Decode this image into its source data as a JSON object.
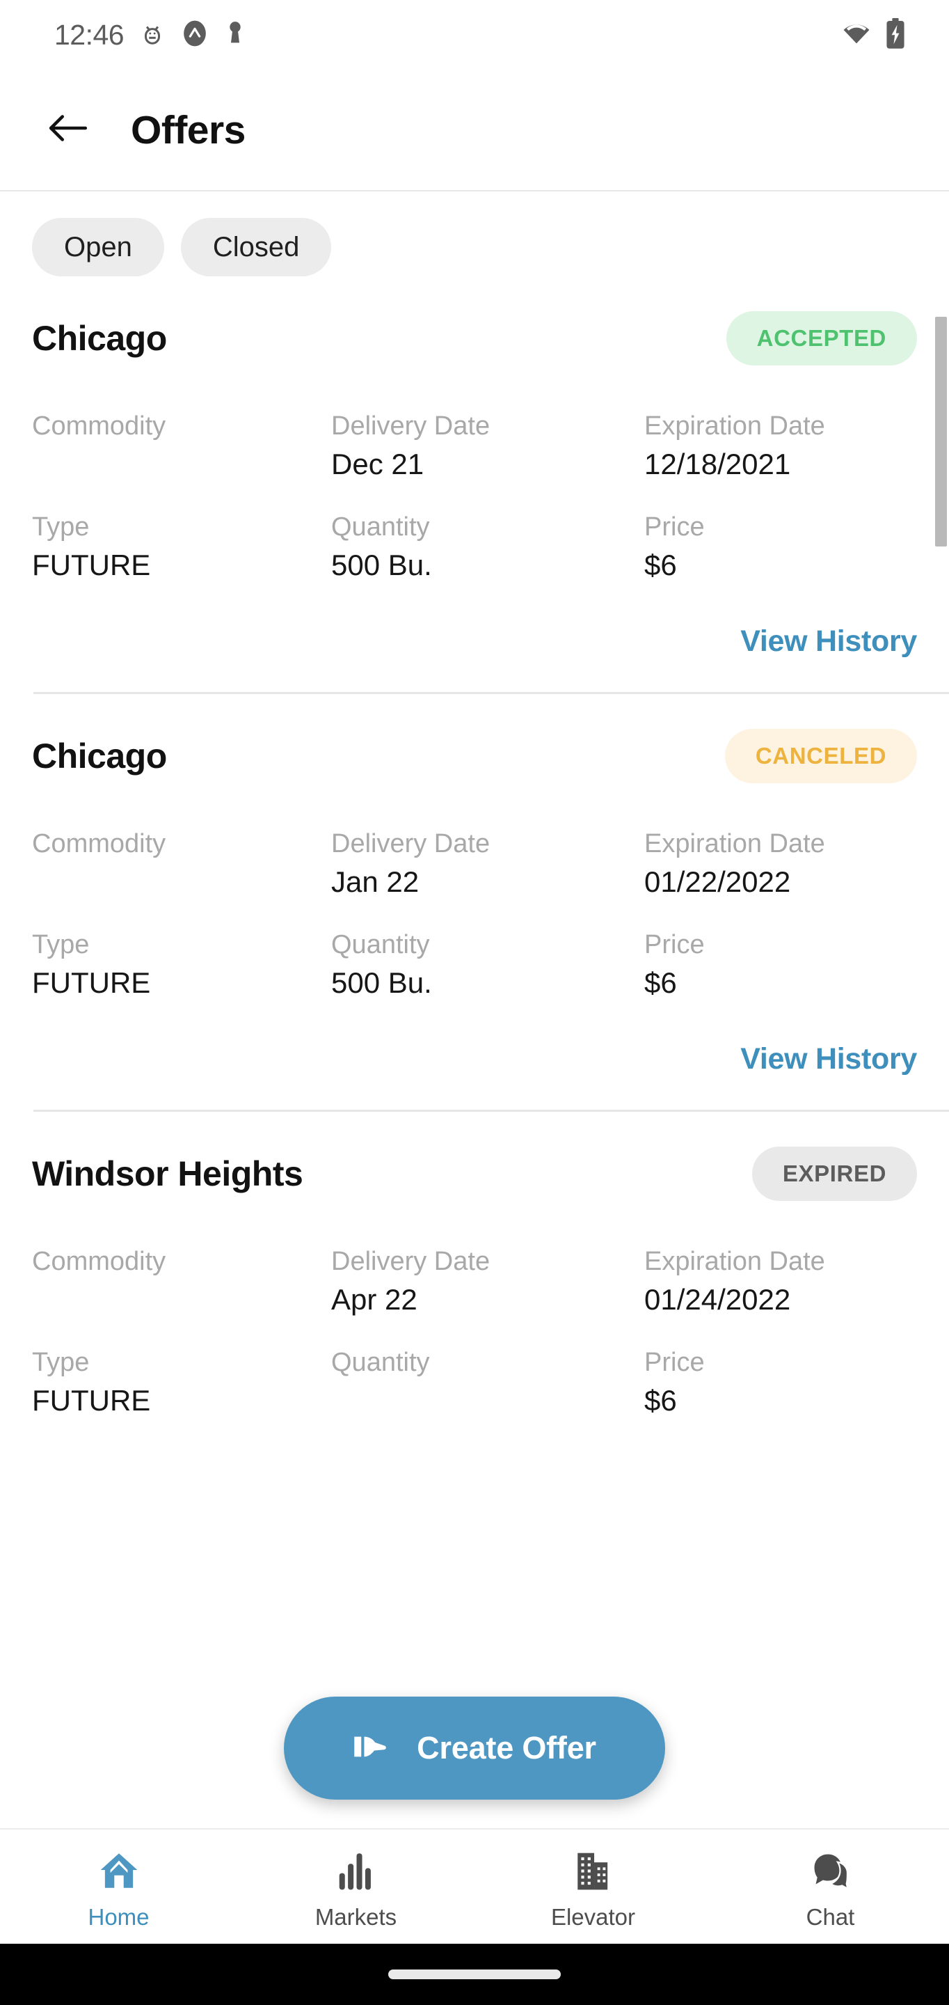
{
  "status_bar": {
    "time": "12:46",
    "left_icons": [
      "android-debug-icon",
      "app-badge-icon",
      "keyhole-icon"
    ],
    "right_icons": [
      "wifi-icon",
      "battery-charging-icon"
    ]
  },
  "header": {
    "back_icon": "arrow-left-icon",
    "title": "Offers"
  },
  "filters": {
    "chips": [
      {
        "label": "Open",
        "selected": false
      },
      {
        "label": "Closed",
        "selected": false
      }
    ]
  },
  "labels": {
    "commodity": "Commodity",
    "delivery_date": "Delivery Date",
    "expiration_date": "Expiration Date",
    "type": "Type",
    "quantity": "Quantity",
    "price": "Price",
    "view_history": "View History"
  },
  "offers": [
    {
      "location": "Chicago",
      "status": "ACCEPTED",
      "status_kind": "accepted",
      "commodity": "",
      "delivery_date": "Dec 21",
      "expiration_date": "12/18/2021",
      "type": "FUTURE",
      "quantity": "500 Bu.",
      "price": "$6",
      "view_history": "View History"
    },
    {
      "location": "Chicago",
      "status": "CANCELED",
      "status_kind": "canceled",
      "commodity": "",
      "delivery_date": "Jan 22",
      "expiration_date": "01/22/2022",
      "type": "FUTURE",
      "quantity": "500 Bu.",
      "price": "$6",
      "view_history": "View History"
    },
    {
      "location": "Windsor Heights",
      "status": "EXPIRED",
      "status_kind": "expired",
      "commodity": "",
      "delivery_date": "Apr 22",
      "expiration_date": "01/24/2022",
      "type": "FUTURE",
      "quantity": "",
      "price": "$6",
      "view_history": ""
    }
  ],
  "fab": {
    "label": "Create Offer",
    "icon": "handshake-offer-icon"
  },
  "bottom_nav": {
    "items": [
      {
        "label": "Home",
        "icon": "home-icon",
        "active": true
      },
      {
        "label": "Markets",
        "icon": "bar-chart-icon",
        "active": false
      },
      {
        "label": "Elevator",
        "icon": "buildings-icon",
        "active": false
      },
      {
        "label": "Chat",
        "icon": "chat-bubbles-icon",
        "active": false
      }
    ]
  },
  "colors": {
    "accent_blue": "#3f8fbd",
    "fab_blue": "#4e97c3",
    "accepted_bg": "#dff5e3",
    "accepted_fg": "#4fc26f",
    "canceled_bg": "#fdf3e0",
    "canceled_fg": "#eeb23e",
    "expired_bg": "#e9e9e9",
    "expired_fg": "#5c5c5c",
    "label_gray": "#a8a8a8"
  }
}
